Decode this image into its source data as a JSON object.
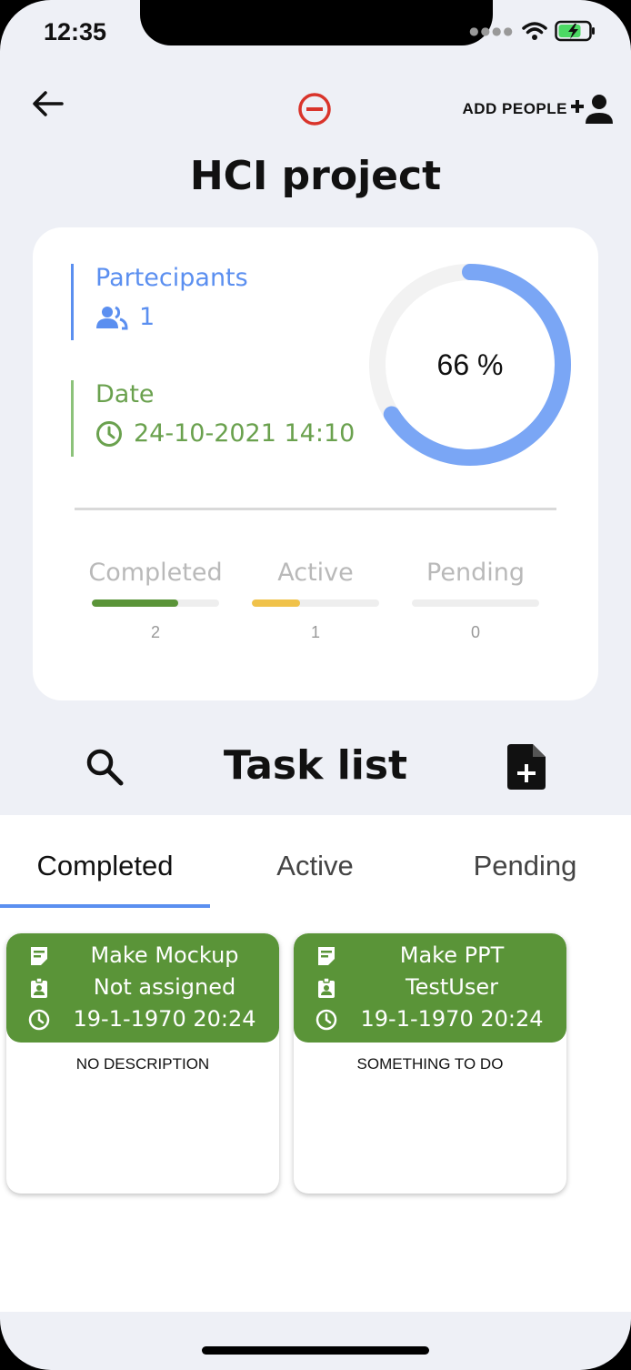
{
  "status_bar": {
    "time": "12:35"
  },
  "header": {
    "title": "HCI project",
    "add_people_label": "ADD PEOPLE"
  },
  "summary": {
    "participants_label": "Partecipants",
    "participants_count": "1",
    "date_label": "Date",
    "date_value": "24-10-2021 14:10",
    "progress_text": "66 %",
    "progress_fraction": 0.66,
    "stats": [
      {
        "label": "Completed",
        "count": "2",
        "fill_fraction": 0.68,
        "color": "#5a9438"
      },
      {
        "label": "Active",
        "count": "1",
        "fill_fraction": 0.38,
        "color": "#f0c24a"
      },
      {
        "label": "Pending",
        "count": "0",
        "fill_fraction": 0,
        "color": "#cccccc"
      }
    ]
  },
  "task_list": {
    "title": "Task list",
    "tabs": [
      {
        "label": "Completed",
        "selected": true
      },
      {
        "label": "Active",
        "selected": false
      },
      {
        "label": "Pending",
        "selected": false
      }
    ],
    "tasks": [
      {
        "name": "Make Mockup",
        "assignee": "Not assigned",
        "datetime": "19-1-1970 20:24",
        "description": "NO DESCRIPTION"
      },
      {
        "name": "Make PPT",
        "assignee": "TestUser",
        "datetime": "19-1-1970 20:24",
        "description": "SOMETHING TO DO"
      }
    ]
  },
  "colors": {
    "accent_blue": "#5b8ff0",
    "green": "#6aa14e",
    "task_header_green": "#5a9438",
    "remove_red": "#d9342b"
  },
  "icons": [
    "back-arrow-icon",
    "remove-circle-icon",
    "person-add-icon",
    "people-icon",
    "clock-icon",
    "search-icon",
    "note-add-icon",
    "note-icon",
    "badge-icon",
    "wifi-icon",
    "battery-icon"
  ]
}
